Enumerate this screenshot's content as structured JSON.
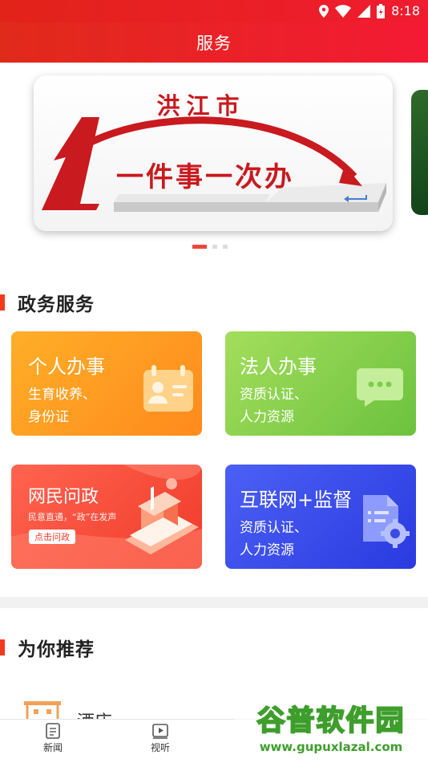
{
  "status_bar": {
    "time": "8:18"
  },
  "header": {
    "title": "服务"
  },
  "banner": {
    "city": "洪江市",
    "slogan": "一件事一次办",
    "numeral": "1",
    "page_count": 3,
    "active_page": 1
  },
  "gov_section": {
    "title": "政务服务",
    "cards": [
      {
        "title": "个人办事",
        "line1": "生育收养、",
        "line2": "身份证",
        "colors": [
          "#ffa51f",
          "#ff8a1c"
        ]
      },
      {
        "title": "法人办事",
        "line1": "资质认证、",
        "line2": "人力资源",
        "colors": [
          "#9bdc55",
          "#6cc23e"
        ]
      },
      {
        "title": "网民问政",
        "line1": "民意直通，“政”在发声",
        "button": "点击问政",
        "colors": [
          "#ff5a48",
          "#f33a2a"
        ]
      },
      {
        "title": "互联网+监督",
        "line1": "资质认证、",
        "line2": "人力资源",
        "colors": [
          "#4a5cf2",
          "#2a3ae0"
        ]
      }
    ]
  },
  "recommend_section": {
    "title": "为你推荐",
    "items": [
      {
        "label": "酒店"
      }
    ]
  },
  "bottom_nav": [
    {
      "label": "新闻",
      "icon": "news-icon"
    },
    {
      "label": "视听",
      "icon": "video-icon"
    }
  ],
  "watermark": {
    "name": "谷普软件园",
    "url": "www.gupuxlazal.com"
  }
}
